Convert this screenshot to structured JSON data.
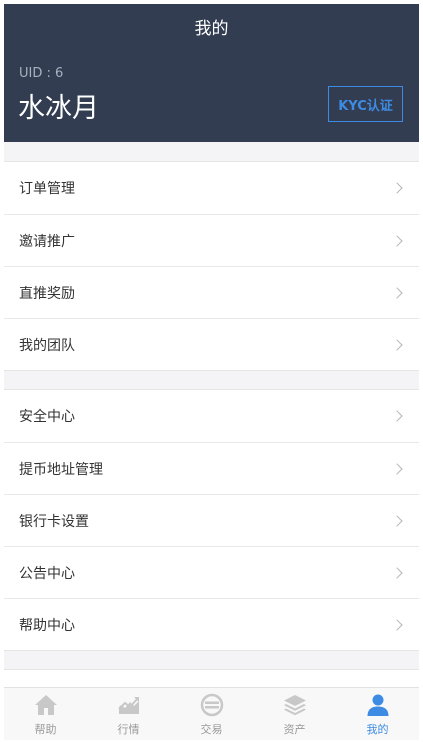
{
  "header": {
    "title": "我的",
    "uid_text": "UID : 6",
    "username": "水冰月",
    "kyc_label": "KYC认证"
  },
  "menu_group_1": [
    {
      "label": "订单管理"
    },
    {
      "label": "邀请推广"
    },
    {
      "label": "直推奖励"
    },
    {
      "label": "我的团队"
    }
  ],
  "menu_group_2": [
    {
      "label": "安全中心"
    },
    {
      "label": "提币地址管理"
    },
    {
      "label": "银行卡设置"
    },
    {
      "label": "公告中心"
    },
    {
      "label": "帮助中心"
    }
  ],
  "tabbar": {
    "active": "我的",
    "tabs": [
      {
        "label": "帮助",
        "icon": "home-icon"
      },
      {
        "label": "行情",
        "icon": "chart-icon"
      },
      {
        "label": "交易",
        "icon": "exchange-icon"
      },
      {
        "label": "资产",
        "icon": "layers-icon"
      },
      {
        "label": "我的",
        "icon": "user-icon"
      }
    ]
  },
  "colors": {
    "header_bg": "#323d52",
    "accent": "#3d8be3",
    "inactive_icon": "#c8c8c8"
  }
}
